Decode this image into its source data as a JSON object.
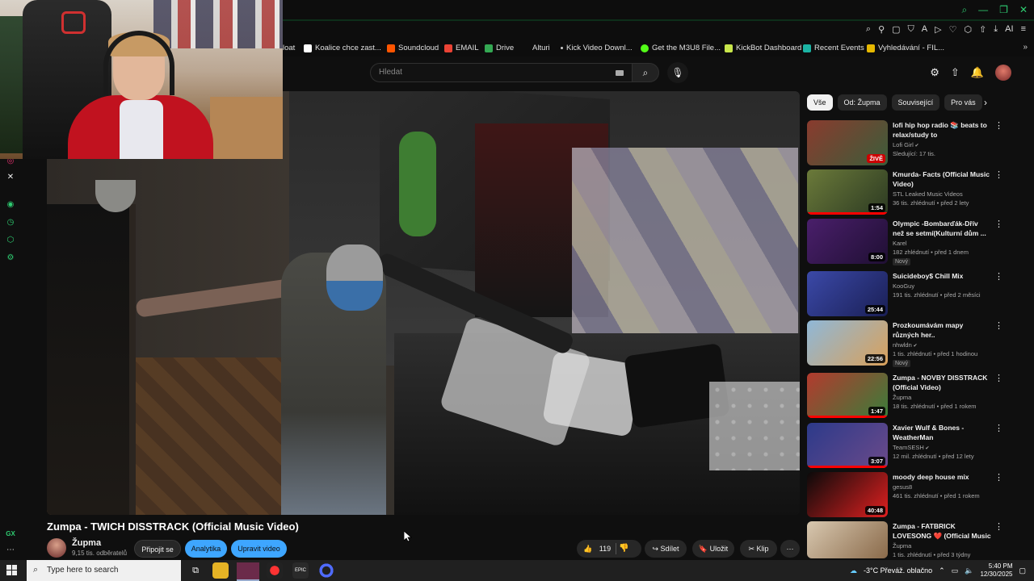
{
  "browser": {
    "window_controls": [
      "search-icon",
      "minimize-icon",
      "maximize-icon",
      "close-icon"
    ],
    "toolbar_label_ai": "AI",
    "bookmarks": [
      {
        "label": "loat",
        "icon": "none",
        "color": ""
      },
      {
        "label": "Koalice chce zast...",
        "icon": "letter-h-icon",
        "color": "#ffffff"
      },
      {
        "label": "Soundcloud",
        "icon": "soundcloud-icon",
        "color": "#ff5500"
      },
      {
        "label": "EMAIL",
        "icon": "gmail-icon",
        "color": "#ea4335"
      },
      {
        "label": "Drive",
        "icon": "drive-icon",
        "color": "#34a853"
      },
      {
        "label": "Alturi",
        "icon": "none",
        "color": ""
      },
      {
        "label": "Kick Video Downl...",
        "icon": "dot-icon",
        "color": "#cccccc"
      },
      {
        "label": "Get the M3U8 File...",
        "icon": "green-circle-icon",
        "color": "#53fc18"
      },
      {
        "label": "KickBot Dashboard",
        "icon": "kickbot-icon",
        "color": "#c8e64b"
      },
      {
        "label": "Recent Events",
        "icon": "events-icon",
        "color": "#1bb3a3"
      },
      {
        "label": "Vyhledávání - FIL...",
        "icon": "fil-icon",
        "color": "#e6b800"
      }
    ]
  },
  "masthead": {
    "search_placeholder": "Hledat"
  },
  "video": {
    "title": "Zumpa - TWICH DISSTRACK (Official Music Video)",
    "channel": "Župma",
    "subscribers": "9,15 tis. odběratelů",
    "join_label": "Připojit se",
    "analytics_label": "Analytika",
    "edit_label": "Upravit video",
    "likes": "119",
    "share_label": "Sdílet",
    "save_label": "Uložit",
    "clip_label": "Klip"
  },
  "chips": [
    "Vše",
    "Od: Župma",
    "Související",
    "Pro vás"
  ],
  "recommendations": [
    {
      "title": "lofi hip hop radio 📚 beats to relax/study to",
      "channel": "Lofi Girl",
      "verified": true,
      "meta": "Sledující: 17 tis.",
      "duration": "ŽIVĚ",
      "live": true,
      "badge": "",
      "thumb": [
        "#8a3b2e",
        "#3b5d3a"
      ]
    },
    {
      "title": "Kmurda- Facts (Official Music Video)",
      "channel": "STL Leaked Music Videos",
      "verified": false,
      "meta": "36 tis. zhlédnutí • před 2 lety",
      "duration": "1:54",
      "live": false,
      "badge": "",
      "thumb": [
        "#6b7a3a",
        "#2c3a22"
      ],
      "progress": 1.0
    },
    {
      "title": "Olympic -Bombarďák-Dřív než se setmí(Kulturní dům ...",
      "channel": "Karel",
      "verified": false,
      "meta": "182 zhlédnutí • před 1 dnem",
      "duration": "8:00",
      "live": false,
      "badge": "Nový",
      "thumb": [
        "#4a1f6b",
        "#1f0f33"
      ]
    },
    {
      "title": "Suicideboy$ Chill Mix",
      "channel": "KooGuy",
      "verified": false,
      "meta": "191 tis. zhlédnutí • před 2 měsíci",
      "duration": "25:44",
      "live": false,
      "badge": "",
      "thumb": [
        "#3b49a8",
        "#1a1f55"
      ]
    },
    {
      "title": "Prozkoumávám mapy různých her..",
      "channel": "nhwldn",
      "verified": true,
      "meta": "1 tis. zhlédnutí • před 1 hodinou",
      "duration": "22:56",
      "live": false,
      "badge": "Nový",
      "thumb": [
        "#8fb8d8",
        "#d9a05a"
      ]
    },
    {
      "title": "Zumpa - NOVBY DISSTRACK (Official Video)",
      "channel": "Župma",
      "verified": false,
      "meta": "18 tis. zhlédnutí • před 1 rokem",
      "duration": "1:47",
      "live": false,
      "badge": "",
      "thumb": [
        "#b33a2e",
        "#3a7d3a"
      ],
      "progress": 1.0
    },
    {
      "title": "Xavier Wulf & Bones - WeatherMan",
      "channel": "TeamSESH",
      "verified": true,
      "meta": "12 mil. zhlédnutí • před 12 lety",
      "duration": "3:07",
      "live": false,
      "badge": "",
      "thumb": [
        "#2c3a8a",
        "#6b4a8a"
      ],
      "progress": 1.0
    },
    {
      "title": "moody deep house mix",
      "channel": "gesus8",
      "verified": false,
      "meta": "461 tis. zhlédnutí • před 1 rokem",
      "duration": "40:48",
      "live": false,
      "badge": "",
      "thumb": [
        "#0a0a0a",
        "#e02020"
      ]
    },
    {
      "title": "Zumpa - FATBRICK LOVESONG ❤️ (Official Music Video)",
      "channel": "Župma",
      "verified": false,
      "meta": "1 tis. zhlédnutí • před 3 týdny",
      "duration": "",
      "live": false,
      "badge": "",
      "thumb": [
        "#d8c8b0",
        "#8a6a4a"
      ]
    }
  ],
  "taskbar": {
    "search_placeholder": "Type here to search",
    "weather": "-3°C  Převáž. oblačno",
    "time": "5:40 PM",
    "date": "12/30/2025"
  },
  "left_nav": {
    "bottom_label": "GX"
  },
  "colors": {
    "accent_blue": "#3ea6ff",
    "opera_green": "#2ecc71",
    "background": "#0f0f0f"
  }
}
